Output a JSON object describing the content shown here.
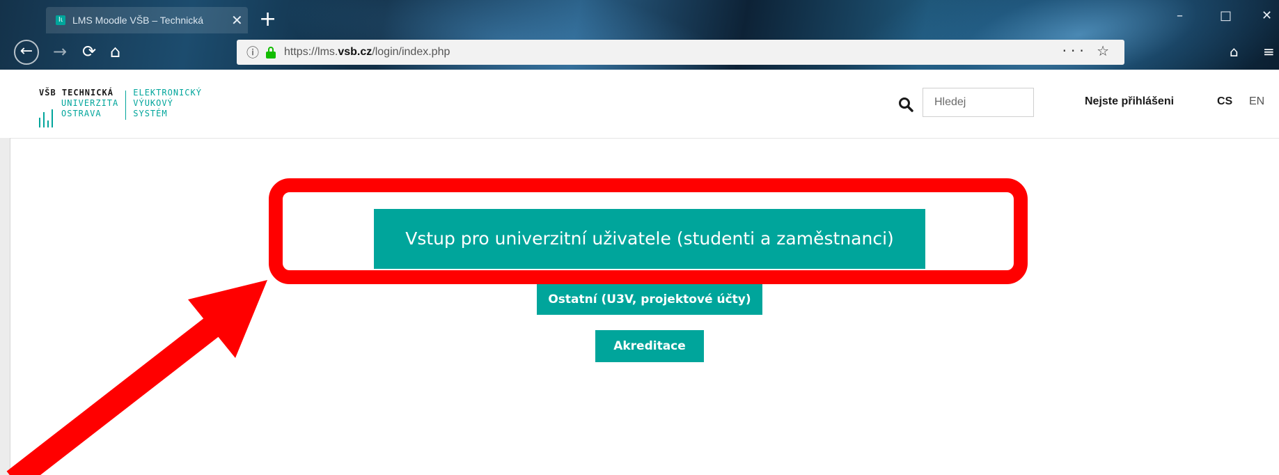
{
  "browser": {
    "tab_title": "LMS Moodle VŠB – Technická",
    "tab_close": "✕",
    "new_tab": "+",
    "url_prefix": "https://lms.",
    "url_domain": "vsb.cz",
    "url_path": "/login/index.php",
    "more_actions": "···",
    "bookmark": "☆",
    "window_minimize": "–",
    "window_maximize": "□",
    "window_close": "✕"
  },
  "header": {
    "logo": {
      "col1": [
        "VŠB TECHNICKÁ",
        "UNIVERZITA",
        "OSTRAVA"
      ],
      "col2": [
        "ELEKTRONICKÝ",
        "VÝUKOVÝ",
        "SYSTÉM"
      ]
    },
    "search_placeholder": "Hledej",
    "login_status": "Nejste přihlášeni",
    "lang_cs": "CS",
    "lang_en": "EN"
  },
  "login_options": {
    "primary_label": "Vstup pro univerzitní uživatele (studenti a zaměstnanci)",
    "other_label": "Ostatní (U3V, projektové účty)",
    "accreditation_label": "Akreditace"
  },
  "colors": {
    "brand": "#00a59b",
    "annotation": "#ff0000"
  }
}
